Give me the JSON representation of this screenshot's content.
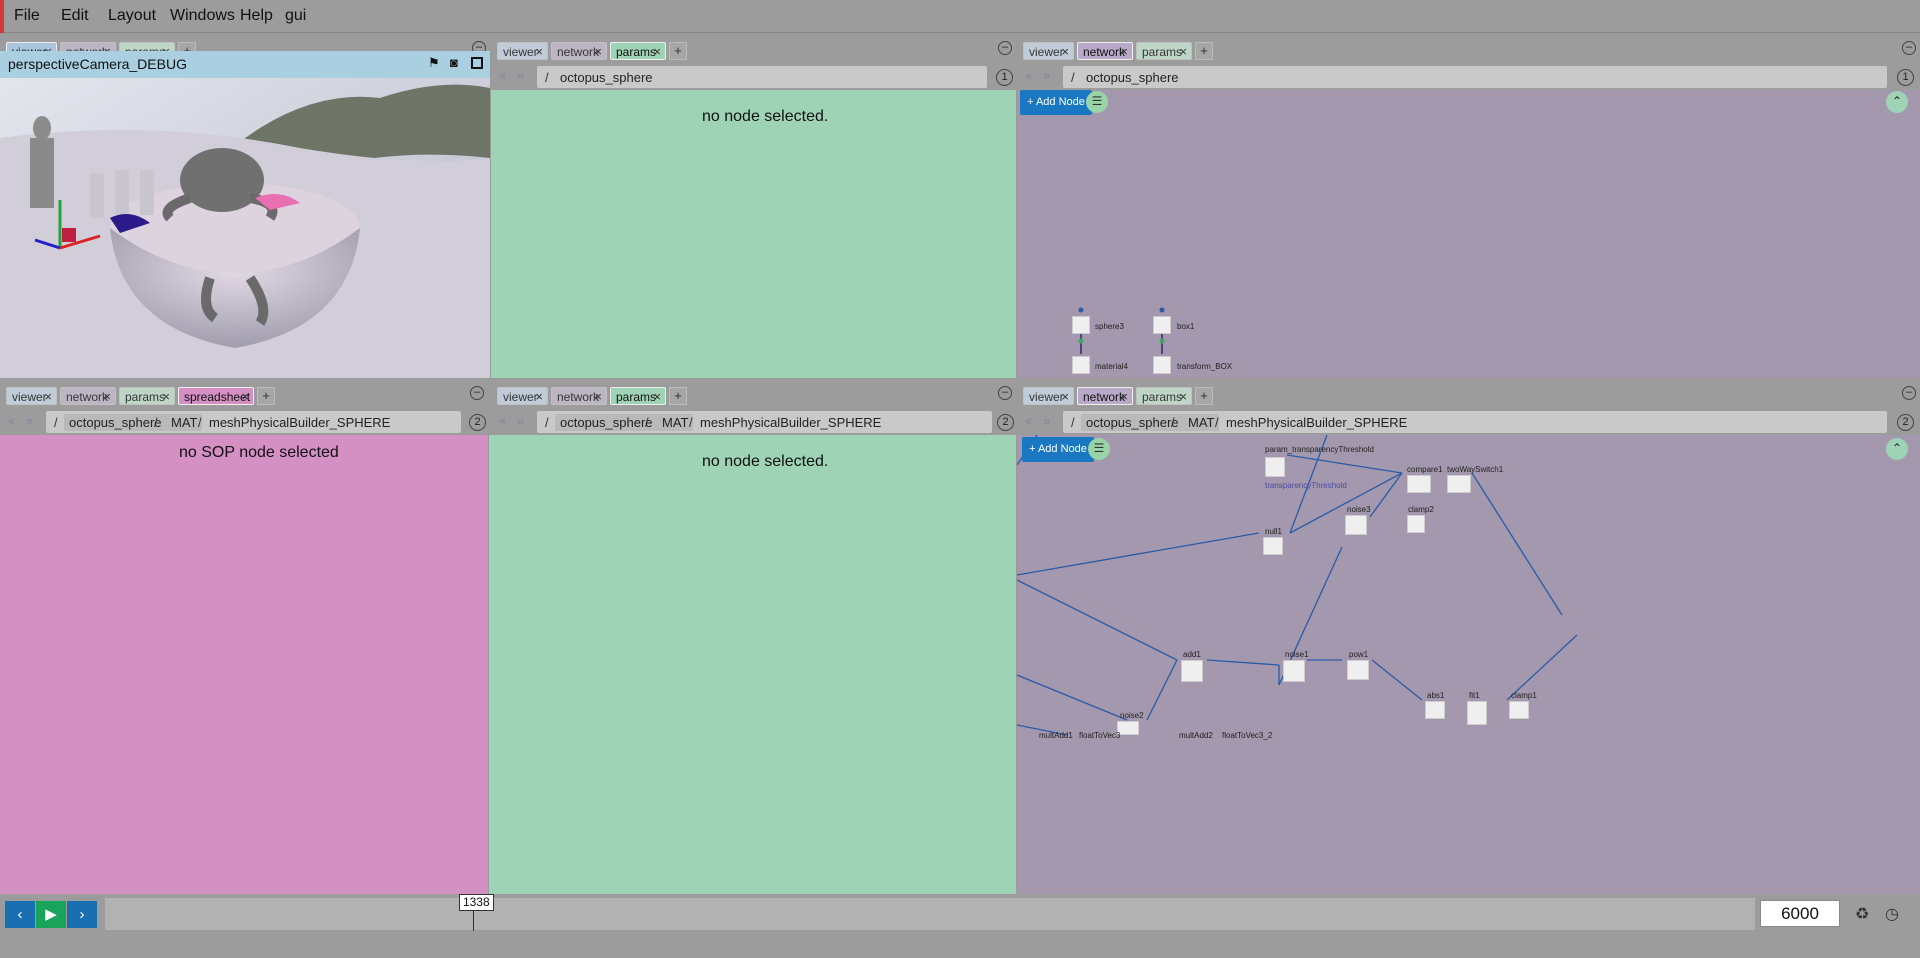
{
  "menu": {
    "file": "File",
    "edit": "Edit",
    "layout": "Layout",
    "windows": "Windows",
    "help": "Help",
    "gui": "gui"
  },
  "tabs": {
    "viewer": "viewer",
    "network": "network",
    "params": "params",
    "spreadsheet": "spreadsheet",
    "plus": "+",
    "close": "×"
  },
  "viewer_tl": {
    "camera_title": "perspectiveCamera_DEBUG",
    "icons": [
      "flag-icon",
      "camera-icon",
      "square-icon"
    ]
  },
  "crumbs": {
    "root": "/",
    "octopus": "octopus_sphere",
    "mat": "MAT",
    "mesh": "meshPhysicalBuilder_SPHERE",
    "sep": "/"
  },
  "messages": {
    "no_node": "no node selected.",
    "no_sop": "no SOP node selected"
  },
  "pane_numbers": {
    "one": "1",
    "two": "2"
  },
  "network": {
    "add_node": "+ Add Node",
    "top_nodes": [
      "sphere3",
      "box1",
      "material4",
      "transform_BOX"
    ],
    "bottom_nodes": [
      "param_transparencyThreshold",
      "transparencyThreshold",
      "compare1",
      "twoWaySwitch1",
      "noise3",
      "clamp2",
      "null1",
      "add1",
      "noise1",
      "pow1",
      "abs1",
      "fit1",
      "clamp1",
      "noise2",
      "multAdd1",
      "floatToVec3",
      "multAdd2",
      "floatToVec3_2"
    ]
  },
  "timeline": {
    "current_frame": "1338",
    "end_frame": "6000",
    "current_fraction": 0.223
  },
  "colors": {
    "viewer": "#a9c6dc",
    "network": "#b8a9c8",
    "params": "#9ed3b6",
    "spreadsheet": "#d48fc3",
    "accent": "#1a78c2"
  }
}
